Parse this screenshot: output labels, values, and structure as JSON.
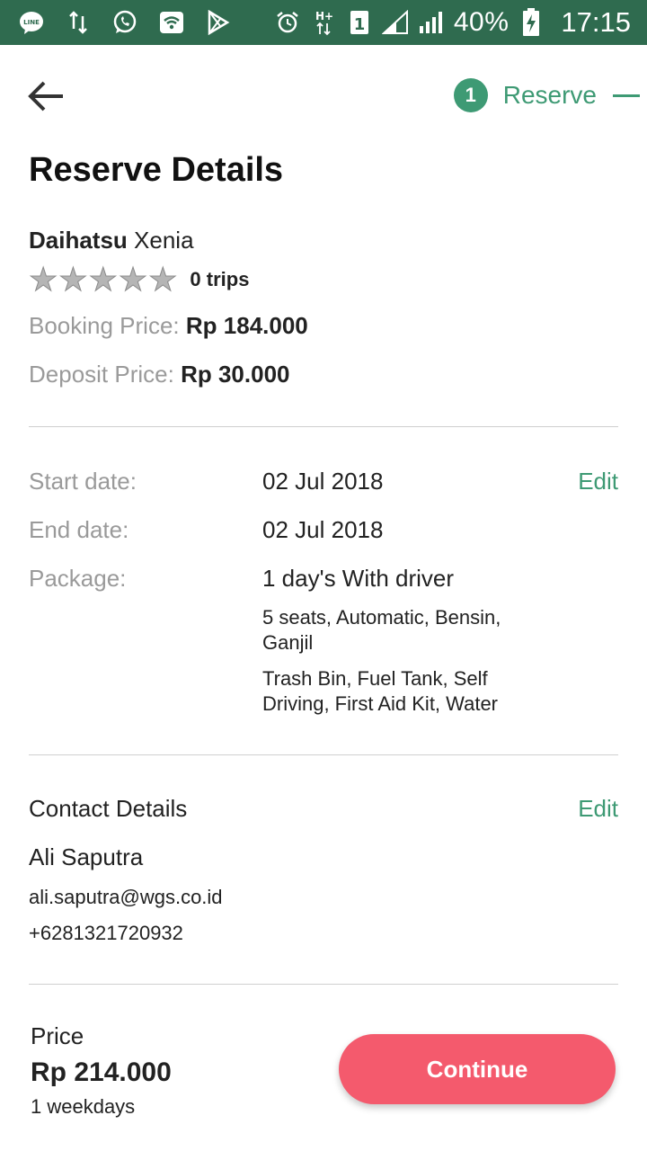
{
  "status_bar": {
    "left_icons": [
      "line-icon",
      "data-transfer-icon",
      "whatsapp-icon",
      "wifi-icon",
      "play-store-icon"
    ],
    "right_icons": [
      "alarm-icon",
      "hplus-network-icon",
      "sim-1-icon",
      "signal-1-icon",
      "signal-2-icon",
      "battery-charging-icon"
    ],
    "battery": "40%",
    "time": "17:15",
    "background": "#2f6b4f"
  },
  "header": {
    "back_icon": "arrow-left-icon",
    "step_number": "1",
    "step_label": "Reserve",
    "accent": "#3e9a74"
  },
  "page_title": "Reserve Details",
  "car": {
    "brand": "Daihatsu",
    "model": "Xenia",
    "rating_stars": 0,
    "rating_max": 5,
    "trips": "0 trips",
    "booking_price_label": "Booking Price:",
    "booking_price_value": "Rp 184.000",
    "deposit_price_label": "Deposit Price:",
    "deposit_price_value": "Rp 30.000"
  },
  "booking": {
    "start_label": "Start date:",
    "start_value": "02 Jul 2018",
    "end_label": "End date:",
    "end_value": "02 Jul 2018",
    "package_label": "Package:",
    "package_value": "1 day's With driver",
    "package_specs": "5 seats, Automatic, Bensin, Ganjil",
    "package_features": "Trash Bin, Fuel Tank, Self Driving, First Aid Kit, Water",
    "edit_label": "Edit"
  },
  "contact": {
    "heading": "Contact Details",
    "edit_label": "Edit",
    "name": "Ali Saputra",
    "email": "ali.saputra@wgs.co.id",
    "phone": "+6281321720932"
  },
  "footer": {
    "price_label": "Price",
    "price_value": "Rp 214.000",
    "days": "1 weekdays",
    "continue_label": "Continue",
    "button_color": "#f45a6d"
  }
}
